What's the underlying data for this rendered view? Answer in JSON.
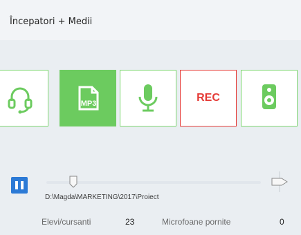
{
  "group": {
    "title": "Începatori + Medii"
  },
  "tiles": [
    {
      "name": "headset",
      "icon": "headset-icon"
    },
    {
      "name": "mp3",
      "icon": "mp3-file-icon",
      "label": "MP3",
      "active": true
    },
    {
      "name": "microphone",
      "icon": "microphone-icon"
    },
    {
      "name": "rec",
      "label": "REC"
    },
    {
      "name": "speaker",
      "icon": "speaker-icon"
    }
  ],
  "player": {
    "state": "paused",
    "file_path": "D:\\Magda\\MARKETING\\2017\\Proiect"
  },
  "stats": {
    "students_label": "Elevi/cursanti",
    "students_value": "23",
    "mics_label": "Microfoane pornite",
    "mics_value": "0"
  },
  "colors": {
    "green": "#6ccb5f",
    "green_border": "#7bd66e",
    "red": "#e53935",
    "blue": "#2c7ad6"
  }
}
